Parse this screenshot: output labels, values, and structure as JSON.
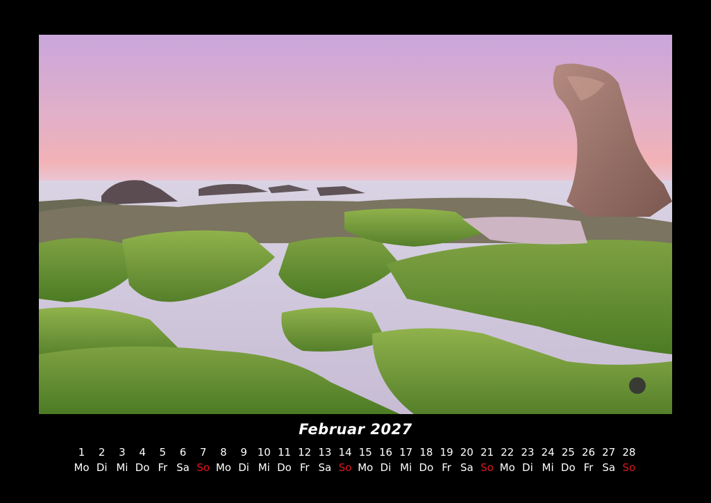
{
  "calendar": {
    "title": "Februar 2027",
    "days": [
      {
        "n": "1",
        "wd": "Mo"
      },
      {
        "n": "2",
        "wd": "Di"
      },
      {
        "n": "3",
        "wd": "Mi"
      },
      {
        "n": "4",
        "wd": "Do"
      },
      {
        "n": "5",
        "wd": "Fr"
      },
      {
        "n": "6",
        "wd": "Sa"
      },
      {
        "n": "7",
        "wd": "So"
      },
      {
        "n": "8",
        "wd": "Mo"
      },
      {
        "n": "9",
        "wd": "Di"
      },
      {
        "n": "10",
        "wd": "Mi"
      },
      {
        "n": "11",
        "wd": "Do"
      },
      {
        "n": "12",
        "wd": "Fr"
      },
      {
        "n": "13",
        "wd": "Sa"
      },
      {
        "n": "14",
        "wd": "So"
      },
      {
        "n": "15",
        "wd": "Mo"
      },
      {
        "n": "16",
        "wd": "Di"
      },
      {
        "n": "17",
        "wd": "Mi"
      },
      {
        "n": "18",
        "wd": "Do"
      },
      {
        "n": "19",
        "wd": "Fr"
      },
      {
        "n": "20",
        "wd": "Sa"
      },
      {
        "n": "21",
        "wd": "So"
      },
      {
        "n": "22",
        "wd": "Mo"
      },
      {
        "n": "23",
        "wd": "Di"
      },
      {
        "n": "24",
        "wd": "Mi"
      },
      {
        "n": "25",
        "wd": "Do"
      },
      {
        "n": "26",
        "wd": "Fr"
      },
      {
        "n": "27",
        "wd": "Sa"
      },
      {
        "n": "28",
        "wd": "So"
      }
    ],
    "sunday_color": "#e0161d",
    "text_color": "#ffffff",
    "background_color": "#000000"
  }
}
